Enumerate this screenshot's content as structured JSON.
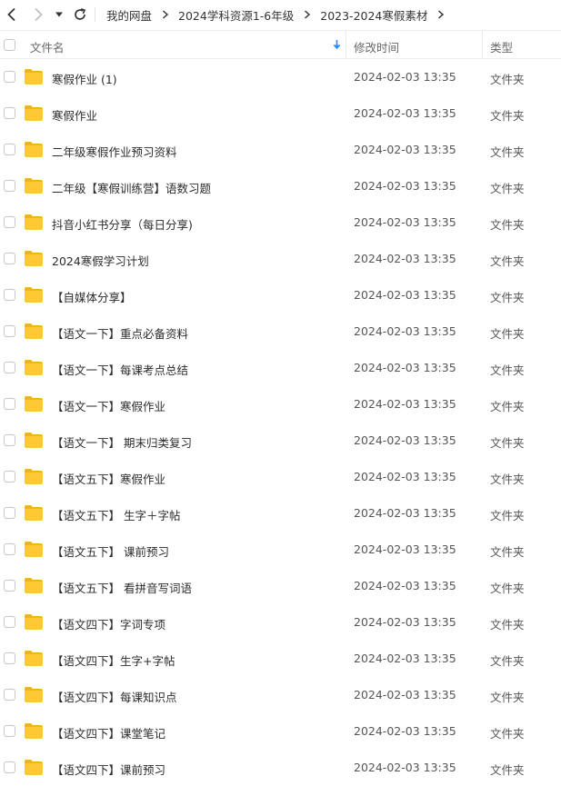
{
  "breadcrumb": {
    "items": [
      "我的网盘",
      "2024学科资源1-6年级",
      "2023-2024寒假素材"
    ]
  },
  "columns": {
    "name": "文件名",
    "modified": "修改时间",
    "type": "类型"
  },
  "files": [
    {
      "name": "寒假作业 (1)",
      "modified": "2024-02-03 13:35",
      "type": "文件夹"
    },
    {
      "name": "寒假作业",
      "modified": "2024-02-03 13:35",
      "type": "文件夹"
    },
    {
      "name": "二年级寒假作业预习资料",
      "modified": "2024-02-03 13:35",
      "type": "文件夹"
    },
    {
      "name": "二年级【寒假训练营】语数习题",
      "modified": "2024-02-03 13:35",
      "type": "文件夹"
    },
    {
      "name": "抖音小红书分享（每日分享)",
      "modified": "2024-02-03 13:35",
      "type": "文件夹"
    },
    {
      "name": "2024寒假学习计划",
      "modified": "2024-02-03 13:35",
      "type": "文件夹"
    },
    {
      "name": "【自媒体分享】",
      "modified": "2024-02-03 13:35",
      "type": "文件夹"
    },
    {
      "name": "【语文一下】重点必备资料",
      "modified": "2024-02-03 13:35",
      "type": "文件夹"
    },
    {
      "name": "【语文一下】每课考点总结",
      "modified": "2024-02-03 13:35",
      "type": "文件夹"
    },
    {
      "name": "【语文一下】寒假作业",
      "modified": "2024-02-03 13:35",
      "type": "文件夹"
    },
    {
      "name": "【语文一下】 期末归类复习",
      "modified": "2024-02-03 13:35",
      "type": "文件夹"
    },
    {
      "name": "【语文五下】寒假作业",
      "modified": "2024-02-03 13:35",
      "type": "文件夹"
    },
    {
      "name": "【语文五下】 生字＋字帖",
      "modified": "2024-02-03 13:35",
      "type": "文件夹"
    },
    {
      "name": "【语文五下】 课前预习",
      "modified": "2024-02-03 13:35",
      "type": "文件夹"
    },
    {
      "name": "【语文五下】 看拼音写词语",
      "modified": "2024-02-03 13:35",
      "type": "文件夹"
    },
    {
      "name": "【语文四下】字词专项",
      "modified": "2024-02-03 13:35",
      "type": "文件夹"
    },
    {
      "name": "【语文四下】生字+字帖",
      "modified": "2024-02-03 13:35",
      "type": "文件夹"
    },
    {
      "name": "【语文四下】每课知识点",
      "modified": "2024-02-03 13:35",
      "type": "文件夹"
    },
    {
      "name": "【语文四下】课堂笔记",
      "modified": "2024-02-03 13:35",
      "type": "文件夹"
    },
    {
      "name": "【语文四下】课前预习",
      "modified": "2024-02-03 13:35",
      "type": "文件夹"
    }
  ],
  "colors": {
    "folder": "#ffc933",
    "folder_tab": "#f2b320",
    "sort_arrow": "#2f8cf0"
  },
  "icons": {
    "back": "chevron-left-icon",
    "forward": "chevron-right-icon",
    "dropdown": "caret-down-icon",
    "refresh": "refresh-icon",
    "sort": "sort-down-arrow-icon",
    "folder": "folder-icon"
  }
}
